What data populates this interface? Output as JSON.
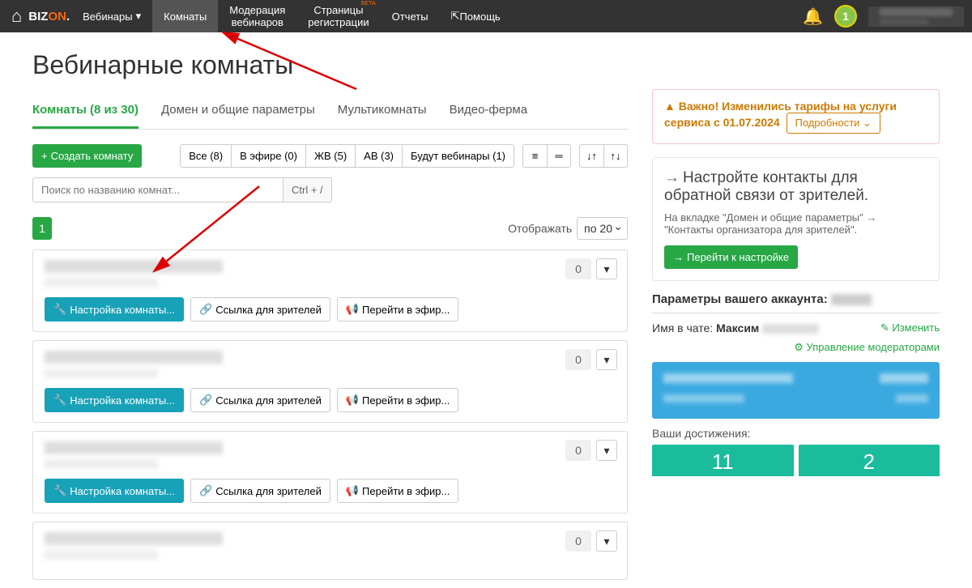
{
  "nav": {
    "brand_pre": "BIZ",
    "brand_on": "ON",
    "brand_suf": ".",
    "webinars": "Вебинары",
    "rooms": "Комнаты",
    "moderation_l1": "Модерация",
    "moderation_l2": "вебинаров",
    "pages_l1": "Страницы",
    "pages_l2": "регистрации",
    "beta": "BETA",
    "reports": "Отчеты",
    "help": "Помощь",
    "avatar": "1"
  },
  "page": {
    "title": "Вебинарные комнаты"
  },
  "tabs": {
    "rooms": "Комнаты (8 из 30)",
    "domain": "Домен и общие параметры",
    "multi": "Мультикомнаты",
    "video": "Видео-ферма"
  },
  "toolbar": {
    "create": "Создать комнату",
    "filter_all": "Все (8)",
    "filter_live": "В эфире (0)",
    "filter_jv": "ЖВ (5)",
    "filter_av": "АВ (3)",
    "filter_upcoming": "Будут вебинары (1)"
  },
  "search": {
    "placeholder": "Поиск по названию комнат...",
    "hint": "Ctrl + /"
  },
  "pager": {
    "page": "1",
    "display_label": "Отображать",
    "display_value": "по 20"
  },
  "room": {
    "settings": "Настройка комнаты...",
    "viewer_link": "Ссылка для зрителей",
    "go_live": "Перейти в эфир...",
    "count": "0"
  },
  "side": {
    "warn_text": "Важно! Изменились тарифы на услуги сервиса с 01.07.2024",
    "warn_btn": "Подробности",
    "contacts_title": "Настройте контакты для обратной связи от зрителей.",
    "contacts_desc": "На вкладке \"Домен и общие параметры\" → \"Контакты организатора для зрителей\".",
    "contacts_btn": "Перейти к настройке",
    "acct_title": "Параметры вашего аккаунта:",
    "chat_label": "Имя в чате:",
    "chat_name": "Максим",
    "edit": "Изменить",
    "moderators": "Управление модераторами",
    "ach_label": "Ваши достижения:",
    "ach1": "11",
    "ach2": "2"
  }
}
